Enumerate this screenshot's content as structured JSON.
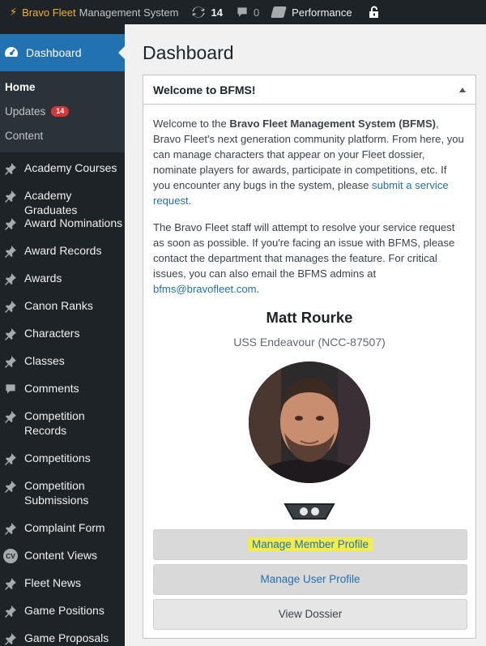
{
  "adminbar": {
    "brand": "Bravo Fleet",
    "brand_sub": "Management System",
    "updates_count": "14",
    "comments_count": "0",
    "performance_label": "Performance",
    "icons": [
      "bolt-icon",
      "updates-icon",
      "comment-icon",
      "performance-icon",
      "lock-icon"
    ]
  },
  "sidebar": {
    "dashboard_label": "Dashboard",
    "submenu": [
      {
        "label": "Home"
      },
      {
        "label": "Updates",
        "badge": "14"
      },
      {
        "label": "Content"
      }
    ],
    "items": [
      {
        "label": "Academy Courses"
      },
      {
        "label": "Academy Graduates"
      },
      {
        "label": "Award Nominations"
      },
      {
        "label": "Award Records"
      },
      {
        "label": "Awards"
      },
      {
        "label": "Canon Ranks"
      },
      {
        "label": "Characters"
      },
      {
        "label": "Classes"
      },
      {
        "label": "Comments"
      },
      {
        "label": "Competition Records"
      },
      {
        "label": "Competitions"
      },
      {
        "label": "Competition Submissions"
      },
      {
        "label": "Complaint Form"
      },
      {
        "label": "Content Views",
        "icon_text": "CV"
      },
      {
        "label": "Fleet News"
      },
      {
        "label": "Game Positions"
      },
      {
        "label": "Game Proposals"
      }
    ]
  },
  "main": {
    "title": "Dashboard",
    "widget_title": "Welcome to BFMS!",
    "para1_a": "Welcome to the ",
    "para1_bold": "Bravo Fleet Management System (BFMS)",
    "para1_b": ", Bravo Fleet's next generation community platform. From here, you can manage characters that appear on your Fleet dossier, nominate players for awards, participate in competitions, etc. If you encounter any bugs in the system, please ",
    "para1_link": "submit a service request",
    "para1_c": ".",
    "para2_a": "The Bravo Fleet staff will attempt to resolve your service request as soon as possible. If you're facing an issue with BFMS, please contact the department that manages the feature. For critical issues, you can also email the BFMS admins at ",
    "para2_link": "bfms@bravofleet.com",
    "para2_b": ".",
    "profile_name": "Matt Rourke",
    "profile_ship": "USS Endeavour (NCC-87507)",
    "btn_member": "Manage Member Profile",
    "btn_user": "Manage User Profile",
    "btn_dossier": "View Dossier"
  }
}
